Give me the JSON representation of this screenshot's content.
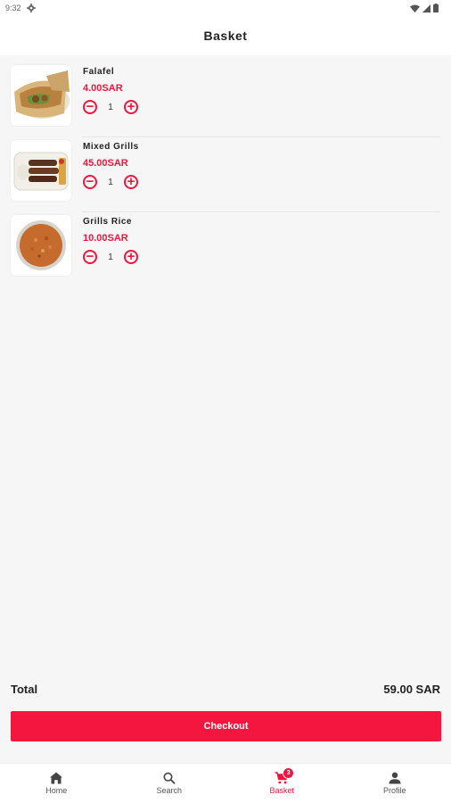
{
  "status_bar": {
    "time": "9:32"
  },
  "header": {
    "title": "Basket"
  },
  "items": [
    {
      "name": "Falafel",
      "price": "4.00SAR",
      "quantity": "1",
      "image_icon": "falafel-wrap-image"
    },
    {
      "name": "Mixed Grills",
      "price": "45.00SAR",
      "quantity": "1",
      "image_icon": "mixed-grills-image"
    },
    {
      "name": "Grills Rice",
      "price": "10.00SAR",
      "quantity": "1",
      "image_icon": "rice-bowl-image"
    }
  ],
  "summary": {
    "total_label": "Total",
    "total_value": "59.00 SAR"
  },
  "checkout": {
    "label": "Checkout"
  },
  "nav": [
    {
      "label": "Home",
      "icon": "home-icon"
    },
    {
      "label": "Search",
      "icon": "search-icon"
    },
    {
      "label": "Basket",
      "icon": "cart-icon",
      "badge": "3",
      "active": true
    },
    {
      "label": "Profile",
      "icon": "person-icon"
    }
  ],
  "colors": {
    "accent": "#f0153e",
    "background": "#f6f6f6",
    "surface": "#ffffff"
  }
}
